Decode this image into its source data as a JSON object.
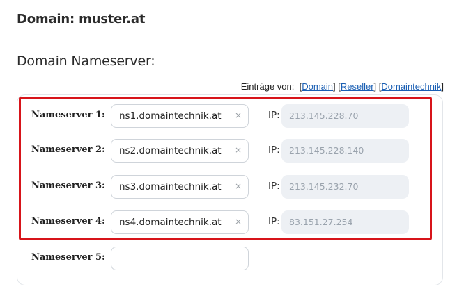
{
  "header": {
    "domain_label": "Domain:",
    "domain_name": "muster.at",
    "section_title": "Domain Nameserver:"
  },
  "entries": {
    "label": "Einträge von:",
    "links": [
      "Domain",
      "Reseller",
      "Domaintechnik"
    ]
  },
  "nameservers": [
    {
      "label": "Nameserver 1:",
      "value": "ns1.domaintechnik.at",
      "ip_label": "IP:",
      "ip": "213.145.228.70"
    },
    {
      "label": "Nameserver 2:",
      "value": "ns2.domaintechnik.at",
      "ip_label": "IP:",
      "ip": "213.145.228.140"
    },
    {
      "label": "Nameserver 3:",
      "value": "ns3.domaintechnik.at",
      "ip_label": "IP:",
      "ip": "213.145.232.70"
    },
    {
      "label": "Nameserver 4:",
      "value": "ns4.domaintechnik.at",
      "ip_label": "IP:",
      "ip": "83.151.27.254"
    },
    {
      "label": "Nameserver 5:",
      "value": ""
    }
  ],
  "clear_glyph": "×",
  "colors": {
    "highlight": "#d7141a",
    "link": "#1a5fb4",
    "ip_field_bg": "#edf0f4"
  }
}
